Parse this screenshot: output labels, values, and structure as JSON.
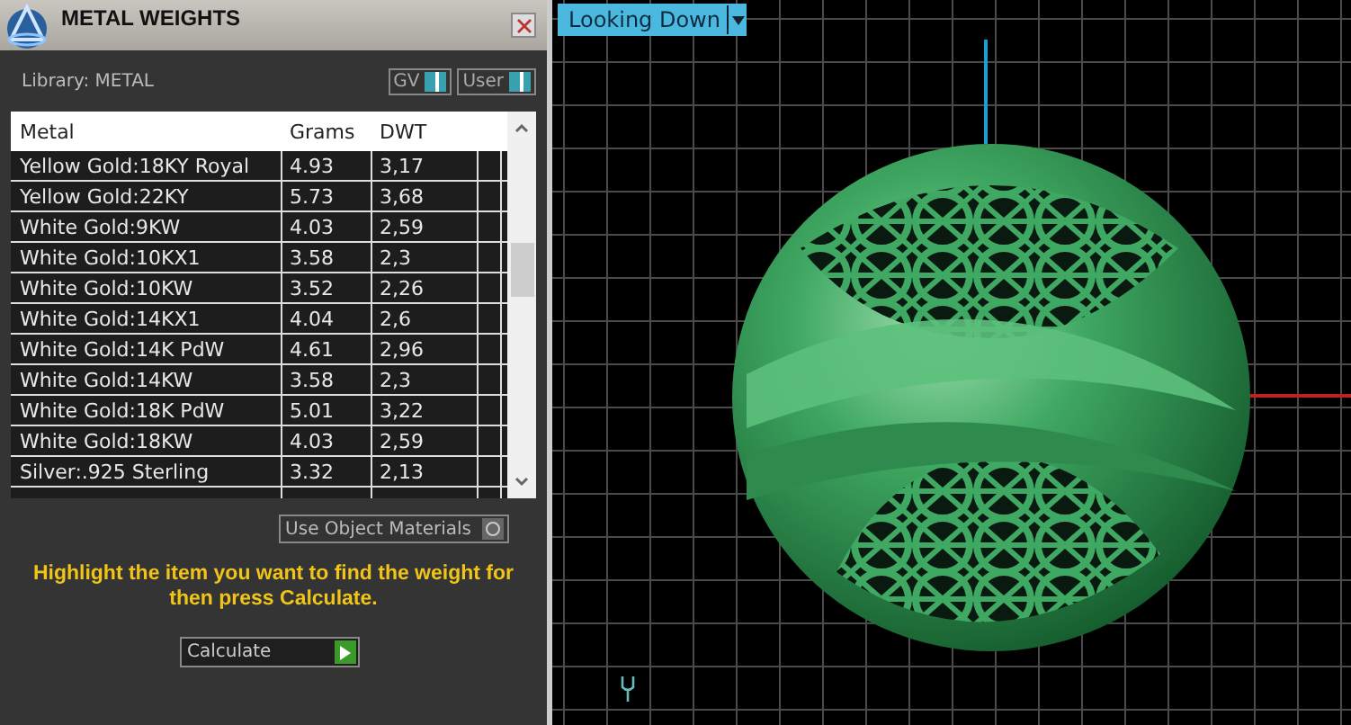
{
  "panel": {
    "title": "METAL WEIGHTS",
    "library_label": "Library: METAL",
    "toggles": [
      {
        "label": "GV",
        "on": true
      },
      {
        "label": "User",
        "on": true
      }
    ],
    "table": {
      "columns": [
        "Metal",
        "Grams",
        "DWT"
      ],
      "rows": [
        {
          "metal": "Yellow Gold:18KY Royal",
          "grams": "4.93",
          "dwt": "3,17"
        },
        {
          "metal": "Yellow Gold:22KY",
          "grams": "5.73",
          "dwt": "3,68"
        },
        {
          "metal": "White Gold:9KW",
          "grams": "4.03",
          "dwt": "2,59"
        },
        {
          "metal": "White Gold:10KX1",
          "grams": "3.58",
          "dwt": "2,3"
        },
        {
          "metal": "White Gold:10KW",
          "grams": "3.52",
          "dwt": "2,26"
        },
        {
          "metal": "White Gold:14KX1",
          "grams": "4.04",
          "dwt": "2,6"
        },
        {
          "metal": "White Gold:14K PdW",
          "grams": "4.61",
          "dwt": "2,96"
        },
        {
          "metal": "White Gold:14KW",
          "grams": "3.58",
          "dwt": "2,3"
        },
        {
          "metal": "White Gold:18K PdW",
          "grams": "5.01",
          "dwt": "3,22"
        },
        {
          "metal": "White Gold:18KW",
          "grams": "4.03",
          "dwt": "2,59"
        },
        {
          "metal": "Silver:.925 Sterling",
          "grams": "3.32",
          "dwt": "2,13"
        }
      ]
    },
    "use_object_materials": {
      "label": "Use Object Materials",
      "on": false
    },
    "hint": "Highlight the item you want to find the weight for then press Calculate.",
    "calculate_button": "Calculate"
  },
  "viewport": {
    "view_dropdown": "Looking Down"
  }
}
